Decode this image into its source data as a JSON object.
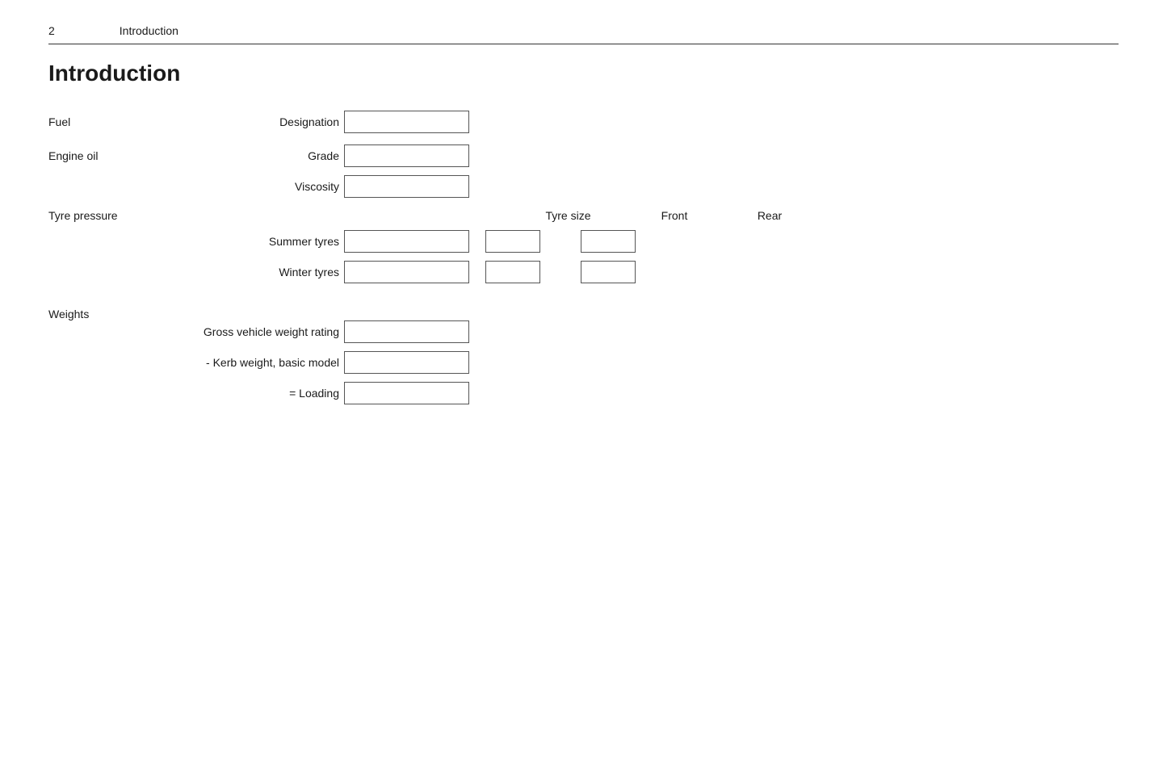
{
  "header": {
    "page_number": "2",
    "title": "Introduction"
  },
  "page_title": "Introduction",
  "sections": {
    "fuel": {
      "label": "Fuel",
      "designation_label": "Designation"
    },
    "engine_oil": {
      "label": "Engine oil",
      "grade_label": "Grade",
      "viscosity_label": "Viscosity"
    },
    "tyre_pressure": {
      "label": "Tyre pressure",
      "col_tyre_size": "Tyre size",
      "col_front": "Front",
      "col_rear": "Rear",
      "summer_label": "Summer tyres",
      "winter_label": "Winter tyres"
    },
    "weights": {
      "label": "Weights",
      "gvwr_label": "Gross vehicle weight rating",
      "kerb_label": "- Kerb weight, basic model",
      "loading_label": "= Loading"
    }
  }
}
